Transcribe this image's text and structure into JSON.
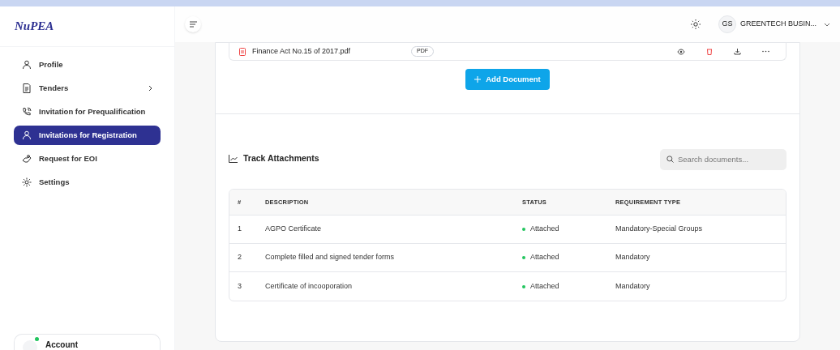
{
  "sidebar": {
    "logo": "NuPEA",
    "items": [
      {
        "label": "Profile",
        "selected": false,
        "has_submenu": false
      },
      {
        "label": "Tenders",
        "selected": false,
        "has_submenu": true
      },
      {
        "label": "Invitation for Prequalification",
        "selected": false,
        "has_submenu": false
      },
      {
        "label": "Invitations for Registration",
        "selected": true,
        "has_submenu": false
      },
      {
        "label": "Request for EOI",
        "selected": false,
        "has_submenu": false
      },
      {
        "label": "Settings",
        "selected": false,
        "has_submenu": false
      }
    ],
    "account": {
      "label": "Account",
      "online": true
    }
  },
  "header": {
    "user_initials": "GS",
    "user_name": "GREENTECH BUSIN..."
  },
  "document": {
    "name": "Finance Act No.15 of 2017.pdf",
    "type": "PDF"
  },
  "add_button": "Add Document",
  "track": {
    "title": "Track Attachments",
    "search": {
      "placeholder": "Search documents..."
    },
    "columns": [
      "#",
      "DESCRIPTION",
      "STATUS",
      "REQUIREMENT TYPE"
    ],
    "rows": [
      {
        "num": "1",
        "description": "AGPO Certificate",
        "status": "Attached",
        "requirement": "Mandatory-Special Groups"
      },
      {
        "num": "2",
        "description": "Complete filled and signed tender forms",
        "status": "Attached",
        "requirement": "Mandatory"
      },
      {
        "num": "3",
        "description": "Certificate of incooporation",
        "status": "Attached",
        "requirement": "Mandatory"
      }
    ]
  }
}
